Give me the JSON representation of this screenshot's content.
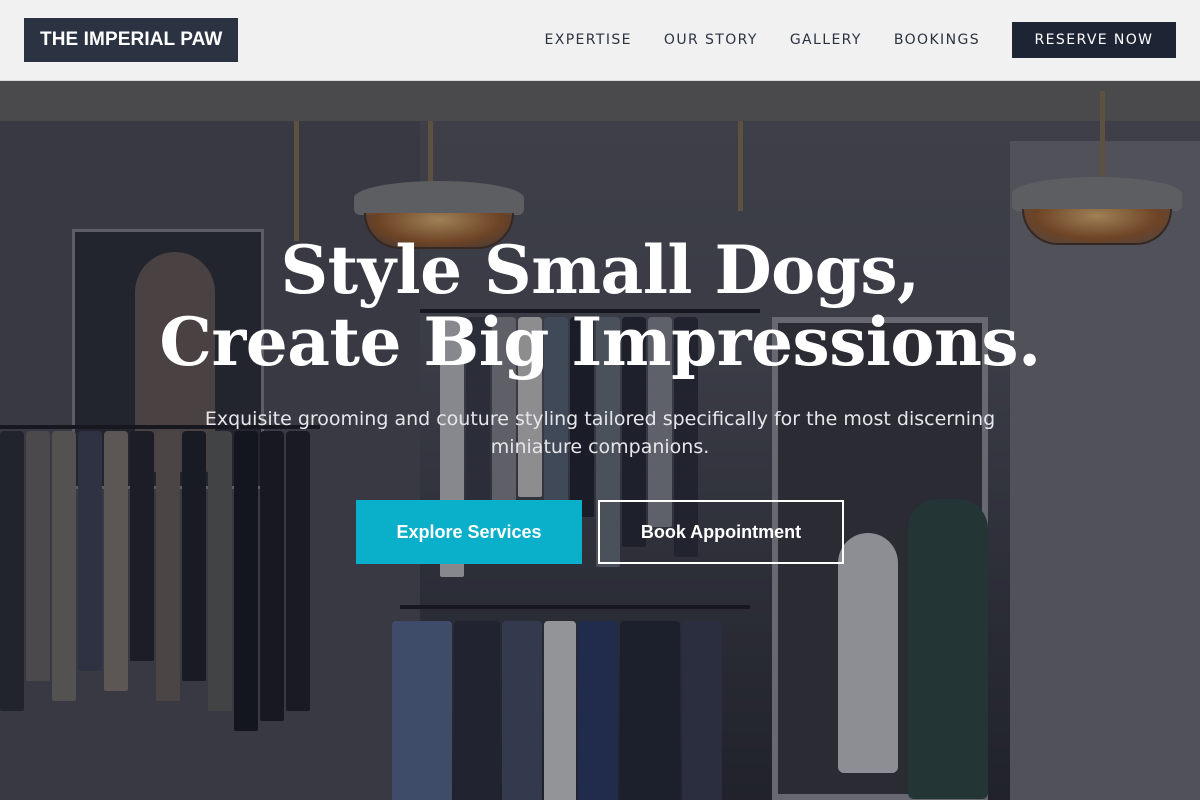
{
  "header": {
    "logo_text": "THE IMPERIAL PAW",
    "nav": [
      {
        "label": "EXPERTISE"
      },
      {
        "label": "OUR STORY"
      },
      {
        "label": "GALLERY"
      },
      {
        "label": "BOOKINGS"
      }
    ],
    "cta_label": "RESERVE NOW"
  },
  "hero": {
    "title_line1": "Style Small Dogs,",
    "title_line2": "Create Big Impressions.",
    "subtitle": "Exquisite grooming and couture styling tailored specifically for the most discerning miniature companions.",
    "primary_button": "Explore Services",
    "secondary_button": "Book Appointment"
  },
  "colors": {
    "header_bg": "#f1f1f1",
    "logo_bg": "#2b3342",
    "cta_bg": "#1d2535",
    "accent": "#0aafc9"
  }
}
